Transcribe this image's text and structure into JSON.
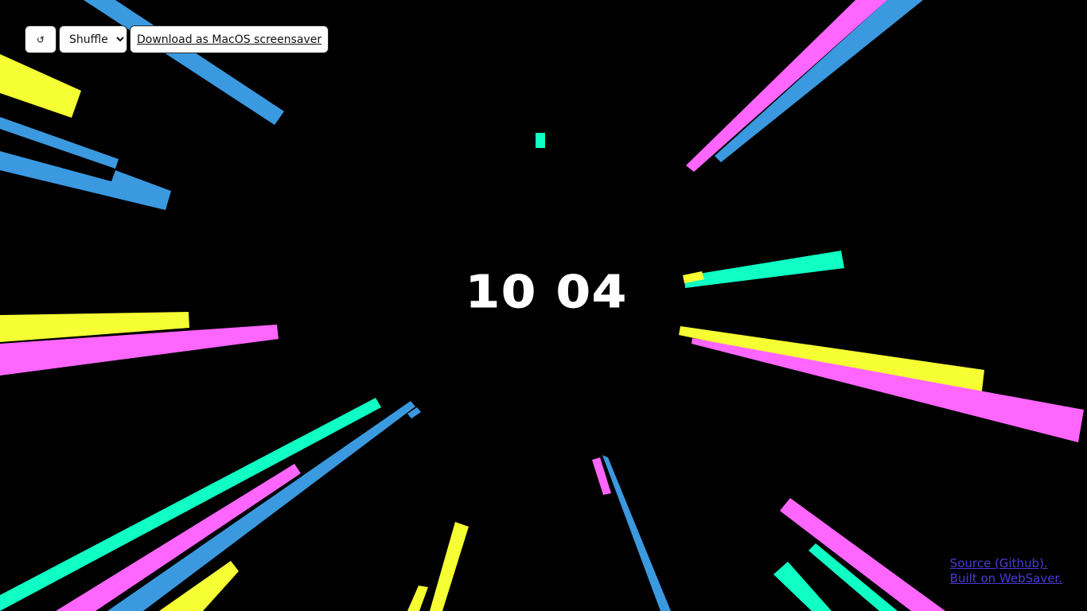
{
  "toolbar": {
    "refresh_label": "↺",
    "mode_select": {
      "selected": "Shuffle"
    },
    "download_label": "Download as MacOS screensaver"
  },
  "clock": {
    "time": "10 04"
  },
  "footer": {
    "source_label": "Source (Github).",
    "built_label": "Built on WebSaver."
  },
  "icons": {
    "refresh": "refresh-icon",
    "dropdown": "chevron-down-icon"
  },
  "colors": {
    "background": "#000000",
    "blue": "#3b99e0",
    "pink": "#ff66ff",
    "yellow": "#f5ff33",
    "teal": "#0fffc4",
    "text": "#ffffff",
    "link": "#4e39d7"
  }
}
